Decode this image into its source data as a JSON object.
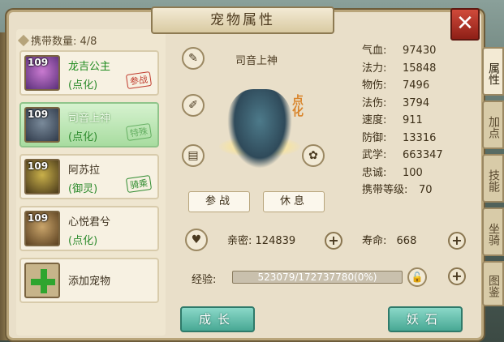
{
  "title": "宠物属性",
  "carry": {
    "label": "携带数量: 4/8"
  },
  "pets": [
    {
      "level": "109",
      "name": "龙吉公主",
      "sub": "(点化)",
      "tag": "参战"
    },
    {
      "level": "109",
      "name": "司音上神",
      "sub": "(点化)",
      "tag": "特殊"
    },
    {
      "level": "109",
      "name": "阿苏拉",
      "sub": "(御灵)",
      "tag": "骑乘"
    },
    {
      "level": "109",
      "name": "心悦君兮",
      "sub": "(点化)",
      "tag": ""
    }
  ],
  "add_pet": "添加宠物",
  "selected_pet": {
    "name": "司音上神",
    "badge": "点化"
  },
  "buttons": {
    "battle": "参战",
    "rest": "休息",
    "grow": "成长",
    "demon_stone": "妖石"
  },
  "stats": [
    {
      "label": "气血:",
      "value": "97430"
    },
    {
      "label": "法力:",
      "value": "15848"
    },
    {
      "label": "物伤:",
      "value": "7496"
    },
    {
      "label": "法伤:",
      "value": "3794"
    },
    {
      "label": "速度:",
      "value": "911"
    },
    {
      "label": "防御:",
      "value": "13316"
    },
    {
      "label": "武学:",
      "value": "663347"
    },
    {
      "label": "忠诚:",
      "value": "100"
    },
    {
      "label": "携带等级:",
      "value": "70"
    }
  ],
  "intimacy": {
    "label": "亲密:",
    "value": "124839"
  },
  "lifespan": {
    "label": "寿命:",
    "value": "668"
  },
  "exp": {
    "label": "经验:",
    "value": "523079/172737780(0%)",
    "progress": 0.003
  },
  "side_tabs": [
    "属性",
    "加点",
    "技能",
    "坐骑",
    "图鉴"
  ],
  "colors": {
    "panel": "#e9dfc9",
    "selected": "#a8dca0",
    "close": "#c0392b",
    "green_button": "#48a894"
  }
}
